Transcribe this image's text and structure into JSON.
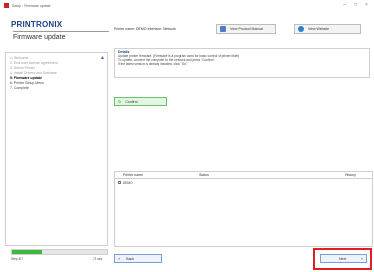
{
  "window": {
    "title": "Setup - Firmware update",
    "controls": [
      "–",
      "□",
      "×"
    ]
  },
  "header": {
    "logo": "PRINTRONIX",
    "page_title": "Firmware update",
    "printer_name": "Printer name: DEMO  Interface: Network",
    "manual_button": "View Product Manual",
    "website_button": "View Website"
  },
  "sidebar": {
    "steps": [
      "1. Welcome",
      "2. End-user license agreement",
      "3. Select Printer",
      "4. Install Drivers and Software",
      "5. Firmware update",
      "6. Printer Setup Menu",
      "7. Complete"
    ],
    "current_index": 4,
    "progress": 0.32,
    "progress_left_label": "Step 5/7",
    "progress_right_label": "71 sec"
  },
  "details": {
    "title": "Details",
    "lines": [
      "Update printer firmware. (Firmware is a program used for basic control of printer itself)",
      "To update, connect the computer to the network and press \"Confirm\".",
      "If the latest version is already installed, click \"Go\"."
    ]
  },
  "confirm_button": "Confirm",
  "table": {
    "columns": [
      "Printer name",
      "Status",
      "History"
    ],
    "rows": [
      {
        "name": "DEMO",
        "status": "",
        "history": ""
      }
    ]
  },
  "footer": {
    "back_button": "Back",
    "next_button": "Next"
  },
  "colors": {
    "logo": "#1d3f8a",
    "progress_fill": "#3fb83f",
    "next_highlight": "#e02020"
  },
  "icons": {
    "manual": "manual-book-icon",
    "website": "globe-icon",
    "confirm": "refresh-icon",
    "back": "chevron-left-icon",
    "next": "chevron-right-icon"
  }
}
